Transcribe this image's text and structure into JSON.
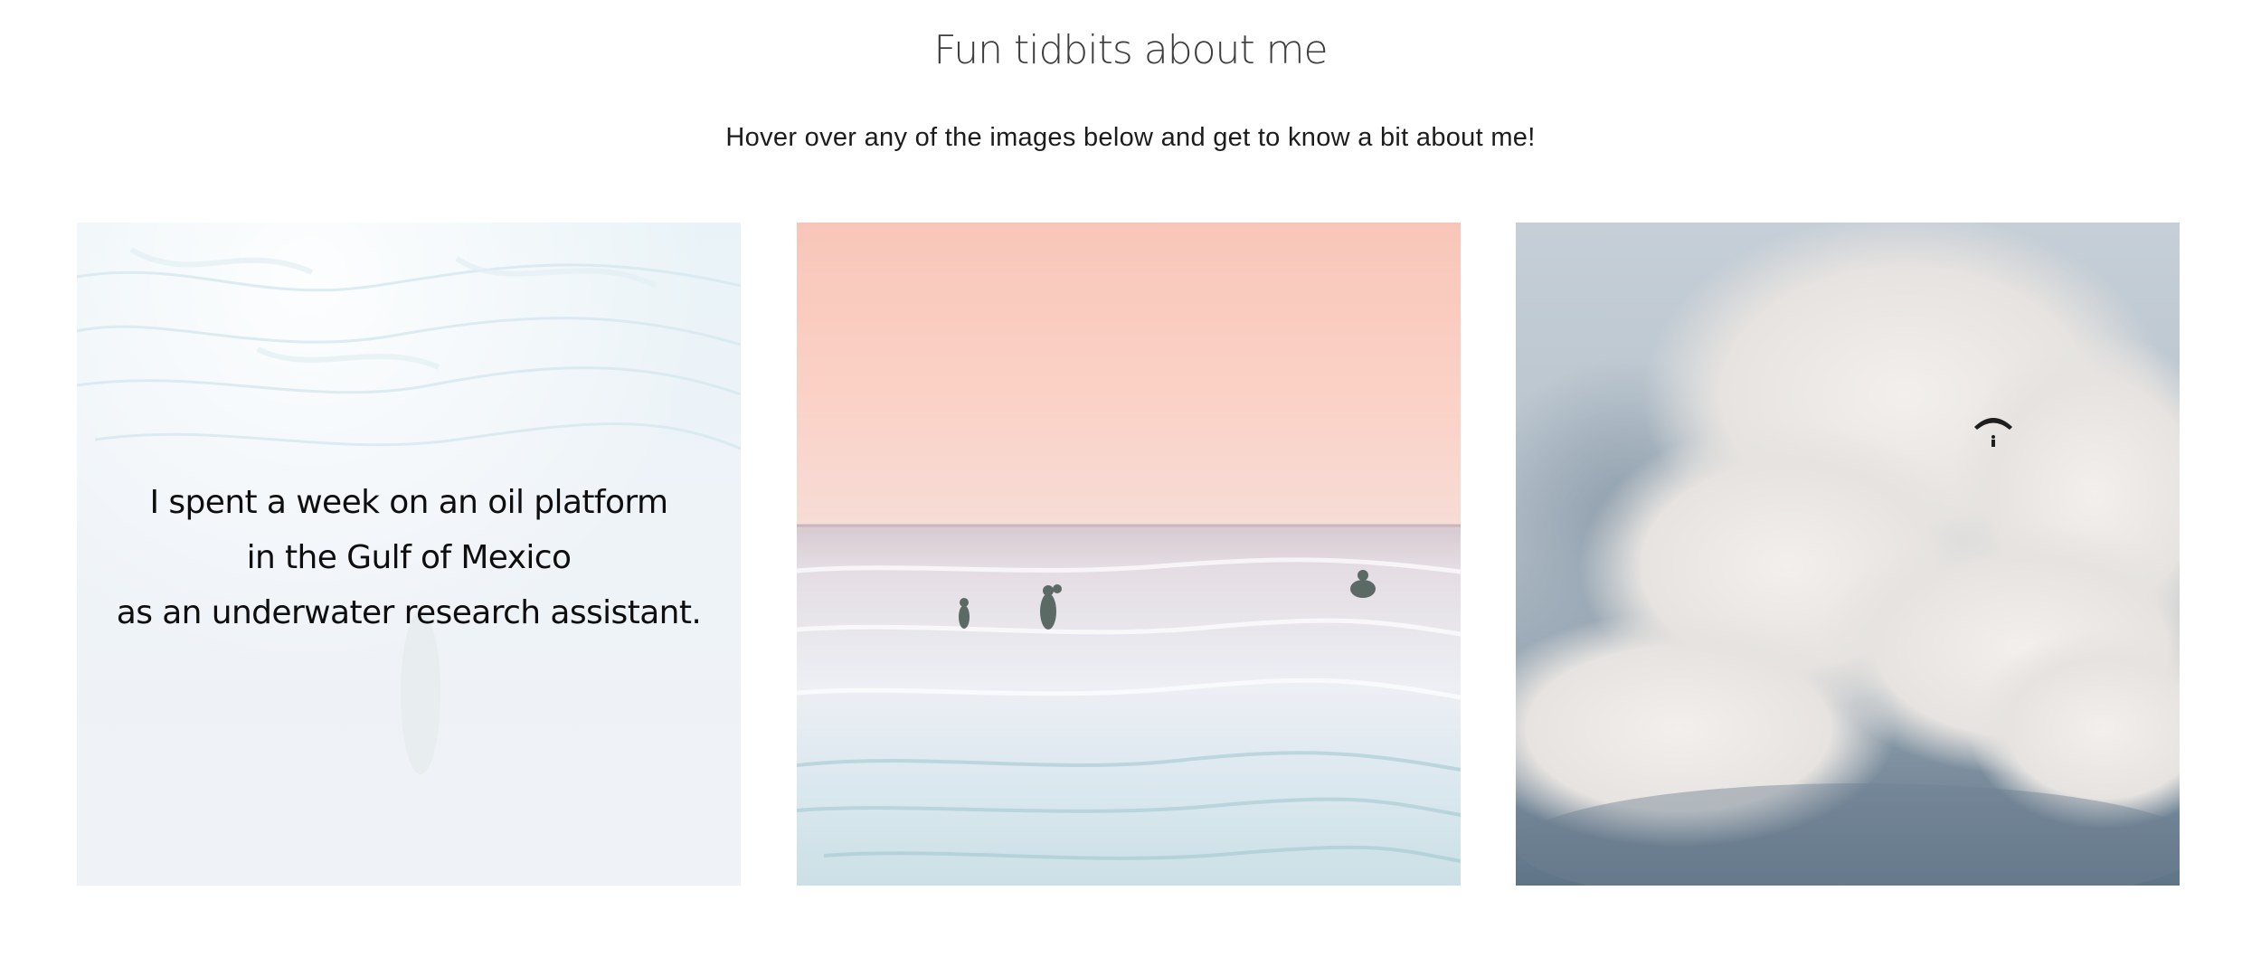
{
  "header": {
    "title": "Fun tidbits about me",
    "subtitle": "Hover over any of the images below and get to know a bit about me!"
  },
  "tiles": [
    {
      "image": "underwater-ocean-photo",
      "hover_text_lines": [
        "I spent a week on an oil platform",
        "in the Gulf of Mexico",
        "as an underwater research assistant."
      ],
      "state": "hovered"
    },
    {
      "image": "surfers-pink-sky-photo",
      "state": "default"
    },
    {
      "image": "skydiver-clouds-photo",
      "state": "default"
    }
  ],
  "colors": {
    "title": "#3d3d3d",
    "text": "#0e0e0e",
    "pink_sky": "#f7c5b9",
    "sea": "#dfe8ee",
    "cloud": "#e6e4e2",
    "cloud_shadow": "#7c8d9c"
  }
}
